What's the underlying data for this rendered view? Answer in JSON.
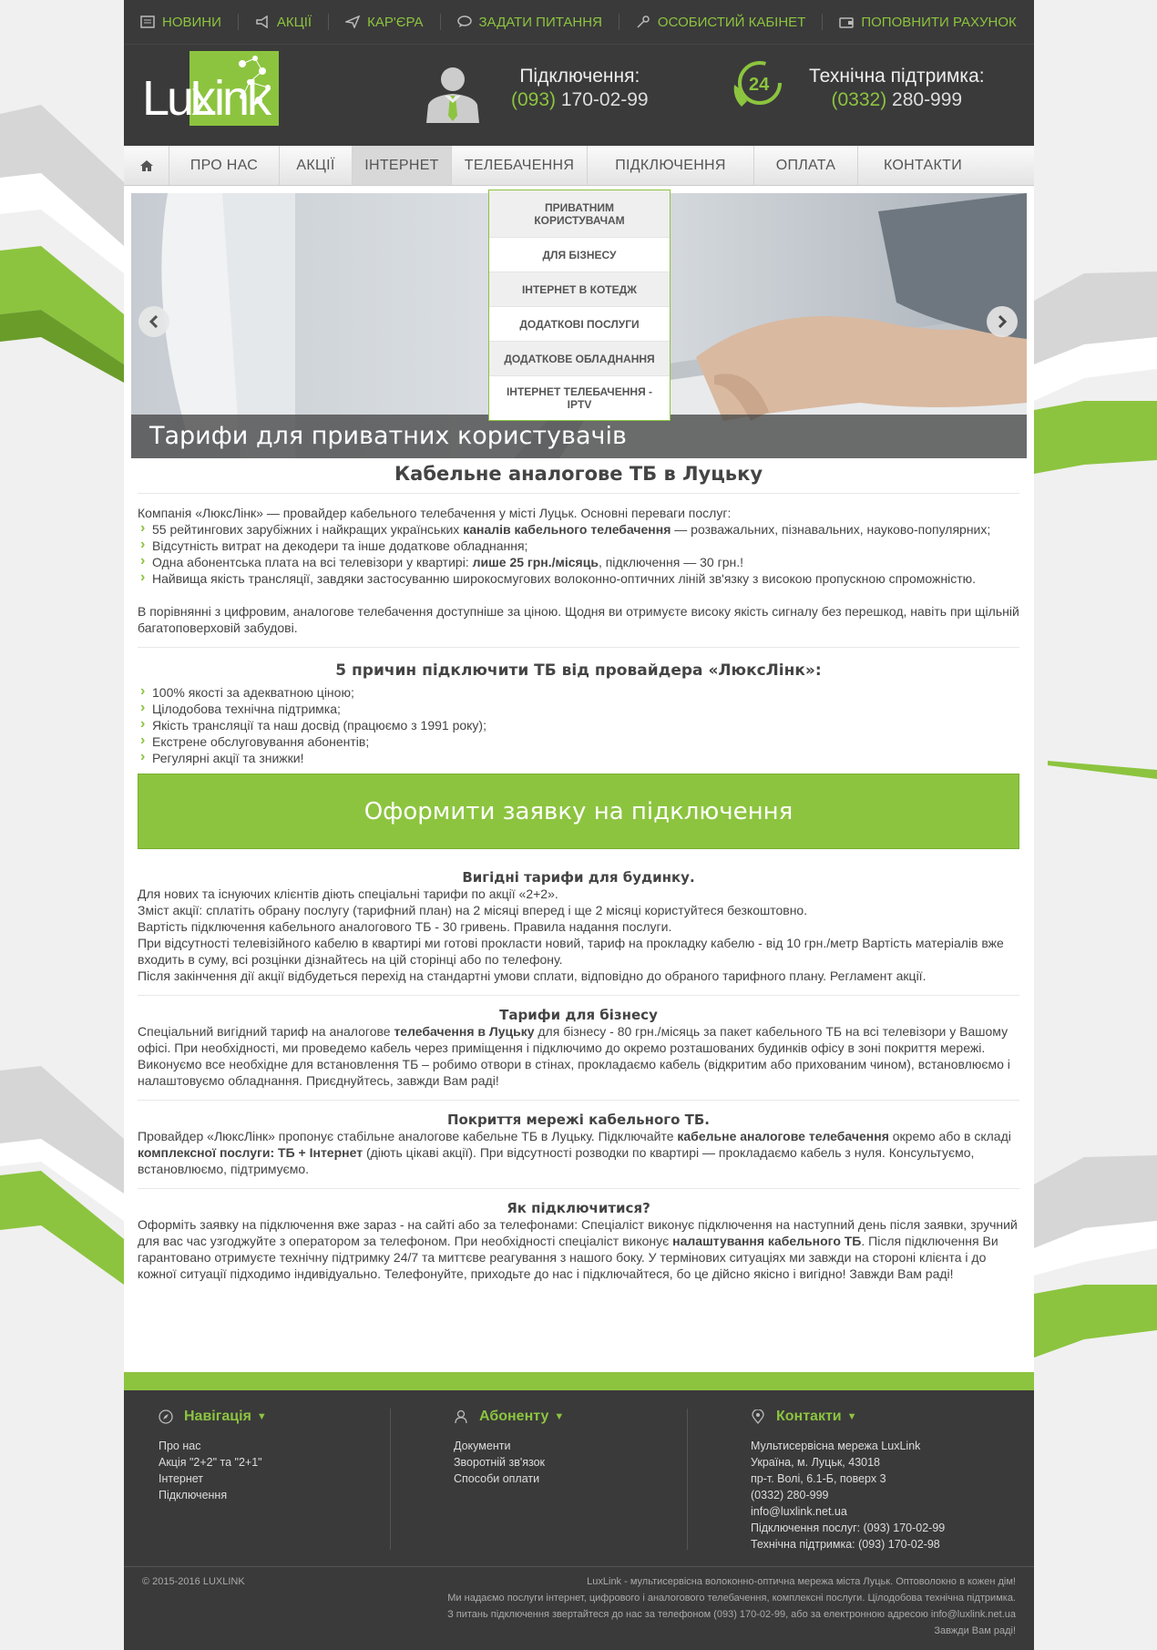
{
  "topbar": {
    "items": [
      {
        "label": "НОВИНИ",
        "icon": "newspaper-icon"
      },
      {
        "label": "АКЦІЇ",
        "icon": "megaphone-icon"
      },
      {
        "label": "КАР'ЄРА",
        "icon": "paper-plane-icon"
      },
      {
        "label": "ЗАДАТИ ПИТАННЯ",
        "icon": "chat-icon"
      },
      {
        "label": "ОСОБИСТИЙ КАБІНЕТ",
        "icon": "key-icon"
      },
      {
        "label": "ПОПОВНИТИ РАХУНОК",
        "icon": "wallet-icon"
      }
    ]
  },
  "header": {
    "logo_text": "LuxLink",
    "connection_label": "Підключення:",
    "connection_code": "(093)",
    "connection_number": "170-02-99",
    "support_label": "Технічна підтримка:",
    "support_code": "(0332)",
    "support_number": "280-999",
    "support_badge": "24"
  },
  "nav": {
    "items": [
      "ПРО НАС",
      "АКЦІЇ",
      "ІНТЕРНЕТ",
      "ТЕЛЕБАЧЕННЯ",
      "ПІДКЛЮЧЕННЯ",
      "ОПЛАТА",
      "КОНТАКТИ"
    ],
    "active": "ІНТЕРНЕТ"
  },
  "dropdown": {
    "items": [
      "ПРИВАТНИМ КОРИСТУВАЧАМ",
      "ДЛЯ БІЗНЕСУ",
      "ІНТЕРНЕТ В КОТЕДЖ",
      "ДОДАТКОВІ ПОСЛУГИ",
      "ДОДАТКОВЕ ОБЛАДНАННЯ",
      "ІНТЕРНЕТ ТЕЛЕБАЧЕННЯ - IPTV"
    ]
  },
  "slider": {
    "caption": "Тарифи для приватних користувачів"
  },
  "content": {
    "title": "Кабельне аналогове ТБ в Луцьку",
    "intro": "Компанія «ЛюксЛінк» — провайдер кабельного телебачення у місті Луцьк. Основні переваги послуг:",
    "advantages": [
      {
        "pre": "55 рейтингових зарубіжних і найкращих українських ",
        "bold": "каналів кабельного телебачення",
        "post": " — розважальних, пізнавальних, науково-популярних;"
      },
      {
        "pre": "Відсутність витрат на декодери та інше додаткове обладнання;",
        "bold": "",
        "post": ""
      },
      {
        "pre": "Одна абонентська плата на всі телевізори у квартирі: ",
        "bold": "лише 25 грн./місяць",
        "post": ", підключення — 30 грн.!"
      },
      {
        "pre": "Найвища якість трансляції, завдяки застосуванню широкосмугових волоконно-оптичних ліній зв'язку з високою пропускною спроможністю.",
        "bold": "",
        "post": ""
      }
    ],
    "compare": "В порівнянні з цифровим, аналогове телебачення доступніше за ціною. Щодня ви отримуєте високу якість сигналу без перешкод, навіть при щільній багатоповерховій забудові.",
    "reasons_title": "5 причин підключити ТБ від провайдера «ЛюксЛінк»:",
    "reasons": [
      "100% якості за адекватною ціною;",
      "Цілодобова технічна підтримка;",
      "Якість трансляції та наш досвід (працюємо з 1991 року);",
      "Екстрене обслуговування абонентів;",
      "Регулярні акції та знижки!"
    ],
    "cta": "Оформити заявку на підключення",
    "s1_title": "Вигідні тарифи для будинку.",
    "s1_lines": [
      "Для нових та існуючих клієнтів діють спеціальні тарифи по акції «2+2».",
      "Зміст акції: сплатіть обрану послугу (тарифний план) на 2 місяці вперед і ще 2 місяці користуйтеся безкоштовно.",
      "Вартість підключення кабельного аналогового ТБ - 30 гривень. Правила надання послуги.",
      "При відсутності телевізійного кабелю в квартирі ми готові прокласти новий, тариф на прокладку кабелю - від 10 грн./метр Вартість матеріалів вже входить в суму, всі розцінки дізнайтесь на цій сторінці або по телефону.",
      "Після закінчення дії акції відбудеться перехід на стандартні умови сплати, відповідно до обраного тарифного плану. Регламент акції."
    ],
    "s2_title": "Тарифи для бізнесу",
    "s2_pre": "Спеціальний вигідний тариф на аналогове ",
    "s2_bold": "телебачення в Луцьку",
    "s2_post": " для бізнесу - 80 грн./місяць за пакет кабельного ТБ на всі телевізори у Вашому офісі. При необхідності, ми проведемо кабель через приміщення і підключимо до окремо розташованих будинків офісу в зоні покриття мережі. Виконуємо все необхідне для встановлення ТБ – робимо отвори в стінах, прокладаємо кабель (відкритим або прихованим чином), встановлюємо і налаштовуємо обладнання. Приєднуйтесь, завжди Вам раді!",
    "s3_title": "Покриття мережі кабельного ТБ.",
    "s3_a": "Провайдер «ЛюксЛінк» пропонує стабільне аналогове кабельне ТБ в Луцьку. Підключайте ",
    "s3_b": "кабельне аналогове телебачення",
    "s3_c": " окремо або в складі ",
    "s3_d": "комплексної послуги: ТБ + Інтернет",
    "s3_e": " (діють цікаві акції). При відсутності розводки по квартирі — прокладаємо кабель з нуля. Консультуємо, встановлюємо, підтримуємо.",
    "s4_title": "Як підключитися?",
    "s4_a": "Оформіть заявку на підключення вже зараз - на сайті або за телефонами: Спеціаліст виконує підключення на наступний день після заявки, зручний для вас час узгоджуйте з оператором за телефоном. При необхідності спеціаліст виконує ",
    "s4_b": "налаштування кабельного ТБ",
    "s4_c": ". Після підключення Ви гарантовано отримуєте технічну підтримку 24/7 та миттєве реагування з нашого боку. У термінових ситуаціях ми завжди на стороні клієнта і до кожної ситуації підходимо індивідуально. Телефонуйте, приходьте до нас і підключайтеся, бо це дійсно якісно і вигідно! Завжди Вам раді!"
  },
  "footer": {
    "nav_title": "Навігація",
    "nav_links": [
      "Про нас",
      "Акція \"2+2\" та \"2+1\"",
      "Інтернет",
      "Підключення"
    ],
    "sub_title": "Абоненту",
    "sub_links": [
      "Документи",
      "Зворотній зв'язок",
      "Способи оплати"
    ],
    "contacts_title": "Контакти",
    "contacts": [
      "Мультисервісна мережа LuxLink",
      "Україна, м. Луцьк, 43018",
      "пр-т. Волі, 6.1-Б, поверх 3",
      "(0332) 280-999",
      "info@luxlink.net.ua",
      "Підключення послуг: (093) 170-02-99",
      "Технічна підтримка: (093) 170-02-98"
    ],
    "copyright": "© 2015-2016 LUXLINK",
    "bottom_lines": [
      "LuxLink - мультисервісна волоконно-оптична мережа міста Луцьк. Оптоволокно в кожен дім!",
      "Ми надаємо послуги інтернет, цифрового і аналогового телебачення, комплексні послуги. Цілодобова технічна підтримка.",
      "З питань підключення звертайтеся до нас за телефоном (093) 170-02-99, або за електронною адресою info@luxlink.net.ua",
      "Завжди Вам раді!"
    ]
  },
  "colors": {
    "accent": "#8cc43f",
    "dark": "#3a3a3a"
  }
}
